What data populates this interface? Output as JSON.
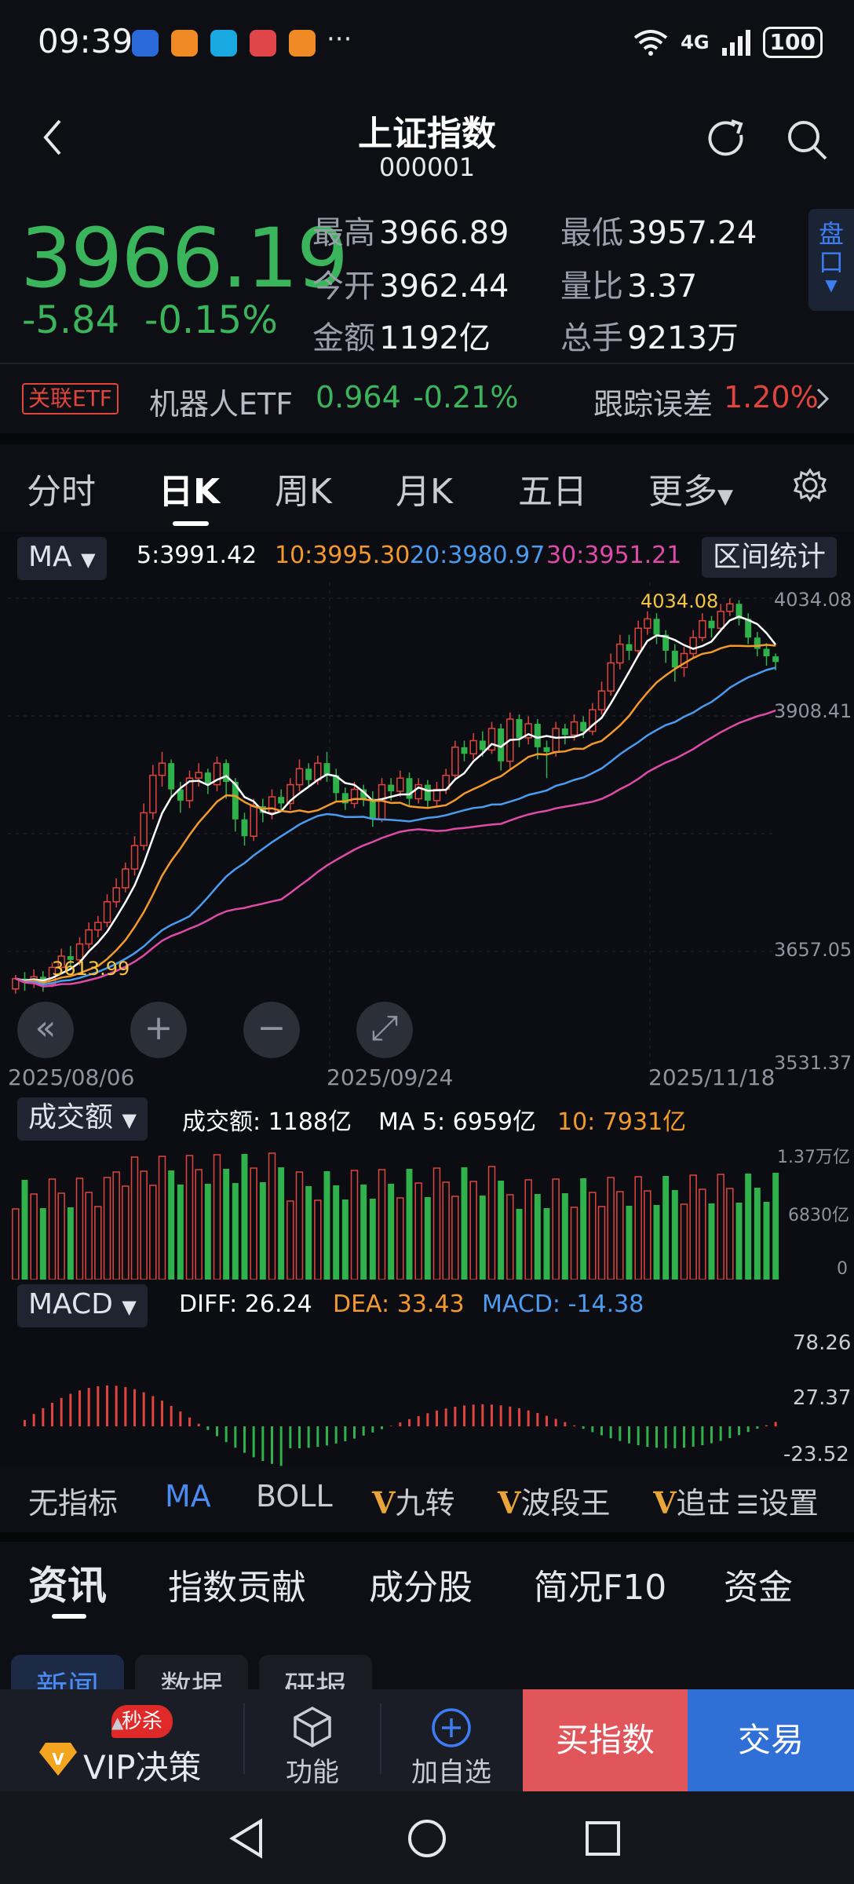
{
  "status_bar": {
    "time": "09:39",
    "signal_text": "4G",
    "battery": "100",
    "dots": "···"
  },
  "header": {
    "title": "上证指数",
    "code": "000001"
  },
  "quote": {
    "price": "3966.19",
    "change": "-5.84",
    "change_pct": "-0.15%",
    "price_color": "#3bb55c",
    "stats": [
      {
        "label": "最高",
        "value": "3966.89"
      },
      {
        "label": "最低",
        "value": "3957.24"
      },
      {
        "label": "今开",
        "value": "3962.44"
      },
      {
        "label": "量比",
        "value": "3.37"
      },
      {
        "label": "金额",
        "value": "1192亿"
      },
      {
        "label": "总手",
        "value": "9213万"
      }
    ],
    "pankou": "盘口"
  },
  "etf_row": {
    "tag": "关联ETF",
    "name": "机器人ETF",
    "price": "0.964",
    "pct": "-0.21%",
    "track_label": "跟踪误差",
    "track_value": "1.20%"
  },
  "period_tabs": [
    {
      "label": "分时"
    },
    {
      "label": "日K"
    },
    {
      "label": "周K"
    },
    {
      "label": "月K"
    },
    {
      "label": "五日"
    },
    {
      "label": "更多"
    }
  ],
  "ma_bar": {
    "selector": "MA",
    "ma5": "5:3991.42",
    "ma10": "10:3995.30",
    "ma20": "20:3980.97",
    "ma30": "30:3951.21",
    "range_stats": "区间统计",
    "colors": {
      "ma5": "#ffffff",
      "ma10": "#f39a2b",
      "ma20": "#4a9cf0",
      "ma30": "#e04aa8"
    }
  },
  "chart_data": {
    "type": "candlestick",
    "y_ticks": [
      "4034.08",
      "3908.41",
      "3657.05",
      "3531.37"
    ],
    "ylim": [
      3531.37,
      4034.08
    ],
    "x_ticks": [
      "2025/08/06",
      "2025/09/24",
      "2025/11/18"
    ],
    "high_annotation": "4034.08",
    "low_annotation": "3613.99",
    "up_color": "#e0443c",
    "down_color": "#2fb24c",
    "candles": [
      [
        3617,
        3628,
        3612,
        3632
      ],
      [
        3628,
        3624,
        3615,
        3635
      ],
      [
        3624,
        3630,
        3618,
        3638
      ],
      [
        3630,
        3622,
        3614,
        3636
      ],
      [
        3622,
        3640,
        3619,
        3645
      ],
      [
        3640,
        3652,
        3635,
        3660
      ],
      [
        3652,
        3648,
        3640,
        3663
      ],
      [
        3648,
        3665,
        3642,
        3672
      ],
      [
        3665,
        3680,
        3660,
        3688
      ],
      [
        3680,
        3688,
        3672,
        3695
      ],
      [
        3688,
        3710,
        3683,
        3718
      ],
      [
        3710,
        3725,
        3704,
        3735
      ],
      [
        3725,
        3745,
        3720,
        3752
      ],
      [
        3745,
        3770,
        3738,
        3780
      ],
      [
        3770,
        3805,
        3765,
        3815
      ],
      [
        3805,
        3845,
        3798,
        3856
      ],
      [
        3845,
        3858,
        3833,
        3870
      ],
      [
        3858,
        3830,
        3822,
        3862
      ],
      [
        3830,
        3818,
        3805,
        3838
      ],
      [
        3818,
        3842,
        3810,
        3850
      ],
      [
        3842,
        3848,
        3833,
        3858
      ],
      [
        3848,
        3835,
        3825,
        3852
      ],
      [
        3835,
        3858,
        3828,
        3865
      ],
      [
        3858,
        3838,
        3820,
        3862
      ],
      [
        3838,
        3798,
        3785,
        3842
      ],
      [
        3798,
        3780,
        3770,
        3805
      ],
      [
        3780,
        3812,
        3775,
        3820
      ],
      [
        3812,
        3805,
        3795,
        3820
      ],
      [
        3805,
        3822,
        3798,
        3830
      ],
      [
        3822,
        3815,
        3808,
        3830
      ],
      [
        3815,
        3835,
        3808,
        3842
      ],
      [
        3835,
        3852,
        3828,
        3862
      ],
      [
        3852,
        3840,
        3832,
        3858
      ],
      [
        3840,
        3858,
        3835,
        3866
      ],
      [
        3858,
        3845,
        3838,
        3870
      ],
      [
        3845,
        3826,
        3818,
        3852
      ],
      [
        3826,
        3815,
        3808,
        3832
      ],
      [
        3815,
        3830,
        3810,
        3838
      ],
      [
        3830,
        3820,
        3812,
        3835
      ],
      [
        3820,
        3798,
        3790,
        3828
      ],
      [
        3798,
        3835,
        3795,
        3842
      ],
      [
        3835,
        3828,
        3818,
        3842
      ],
      [
        3828,
        3842,
        3822,
        3850
      ],
      [
        3842,
        3820,
        3812,
        3848
      ],
      [
        3820,
        3835,
        3815,
        3842
      ],
      [
        3835,
        3818,
        3810,
        3840
      ],
      [
        3818,
        3830,
        3812,
        3838
      ],
      [
        3830,
        3845,
        3825,
        3852
      ],
      [
        3845,
        3875,
        3840,
        3882
      ],
      [
        3875,
        3868,
        3860,
        3882
      ],
      [
        3868,
        3882,
        3862,
        3890
      ],
      [
        3882,
        3872,
        3865,
        3892
      ],
      [
        3872,
        3895,
        3868,
        3902
      ],
      [
        3895,
        3860,
        3850,
        3900
      ],
      [
        3860,
        3905,
        3852,
        3912
      ],
      [
        3905,
        3885,
        3875,
        3910
      ],
      [
        3885,
        3900,
        3878,
        3908
      ],
      [
        3900,
        3875,
        3862,
        3905
      ],
      [
        3875,
        3870,
        3842,
        3882
      ],
      [
        3870,
        3895,
        3865,
        3902
      ],
      [
        3895,
        3888,
        3878,
        3900
      ],
      [
        3888,
        3902,
        3882,
        3910
      ],
      [
        3902,
        3892,
        3885,
        3908
      ],
      [
        3892,
        3915,
        3888,
        3922
      ],
      [
        3915,
        3935,
        3910,
        3945
      ],
      [
        3935,
        3965,
        3930,
        3975
      ],
      [
        3965,
        3985,
        3958,
        3995
      ],
      [
        3985,
        3978,
        3968,
        3995
      ],
      [
        3978,
        4002,
        3972,
        4010
      ],
      [
        4002,
        4012,
        3995,
        4020
      ],
      [
        4012,
        3995,
        3985,
        4018
      ],
      [
        3995,
        3978,
        3965,
        4000
      ],
      [
        3978,
        3960,
        3945,
        3985
      ],
      [
        3960,
        3975,
        3950,
        3982
      ],
      [
        3975,
        3992,
        3970,
        4000
      ],
      [
        3992,
        4010,
        3988,
        4018
      ],
      [
        4010,
        4002,
        3992,
        4015
      ],
      [
        4002,
        4020,
        3998,
        4028
      ],
      [
        4020,
        4028,
        4015,
        4034
      ],
      [
        4028,
        4012,
        4005,
        4032
      ],
      [
        4012,
        3992,
        3985,
        4018
      ],
      [
        3992,
        3980,
        3972,
        3998
      ],
      [
        3980,
        3972,
        3962,
        3986
      ],
      [
        3972,
        3966,
        3957,
        3975
      ]
    ],
    "ma_series": [
      {
        "name": "5",
        "color": "#ffffff"
      },
      {
        "name": "10",
        "color": "#f39a2b"
      },
      {
        "name": "20",
        "color": "#4a9cf0"
      },
      {
        "name": "30",
        "color": "#e04aa8"
      }
    ]
  },
  "chart_controls": [
    "«",
    "+",
    "−",
    "⤢"
  ],
  "volume": {
    "selector": "成交额",
    "readout": "成交额: 1188亿",
    "ma5": "MA 5: 6959亿",
    "ma10": "10: 7931亿",
    "y_ticks": [
      "1.37万亿",
      "6830亿",
      "0"
    ]
  },
  "macd": {
    "selector": "MACD",
    "diff": "DIFF: 26.24",
    "dea": "DEA: 33.43",
    "macd": "MACD: -14.38",
    "y_ticks": [
      "78.26",
      "27.37",
      "-23.52"
    ]
  },
  "indicator_tabs": [
    {
      "label": "无指标"
    },
    {
      "label": "MA"
    },
    {
      "label": "BOLL"
    },
    {
      "label": "九转"
    },
    {
      "label": "波段王"
    },
    {
      "label": "追击"
    }
  ],
  "settings_label": "设置",
  "section_tabs": [
    {
      "label": "资讯"
    },
    {
      "label": "指数贡献"
    },
    {
      "label": "成分股"
    },
    {
      "label": "简况F10"
    },
    {
      "label": "资金"
    }
  ],
  "sub_tabs": [
    {
      "label": "新闻"
    },
    {
      "label": "数据"
    },
    {
      "label": "研报"
    }
  ],
  "bottom_bar": {
    "vip_badge": "秒杀",
    "vip": "VIP决策",
    "func": "功能",
    "watch": "加自选",
    "buy": "买指数",
    "trade": "交易"
  }
}
